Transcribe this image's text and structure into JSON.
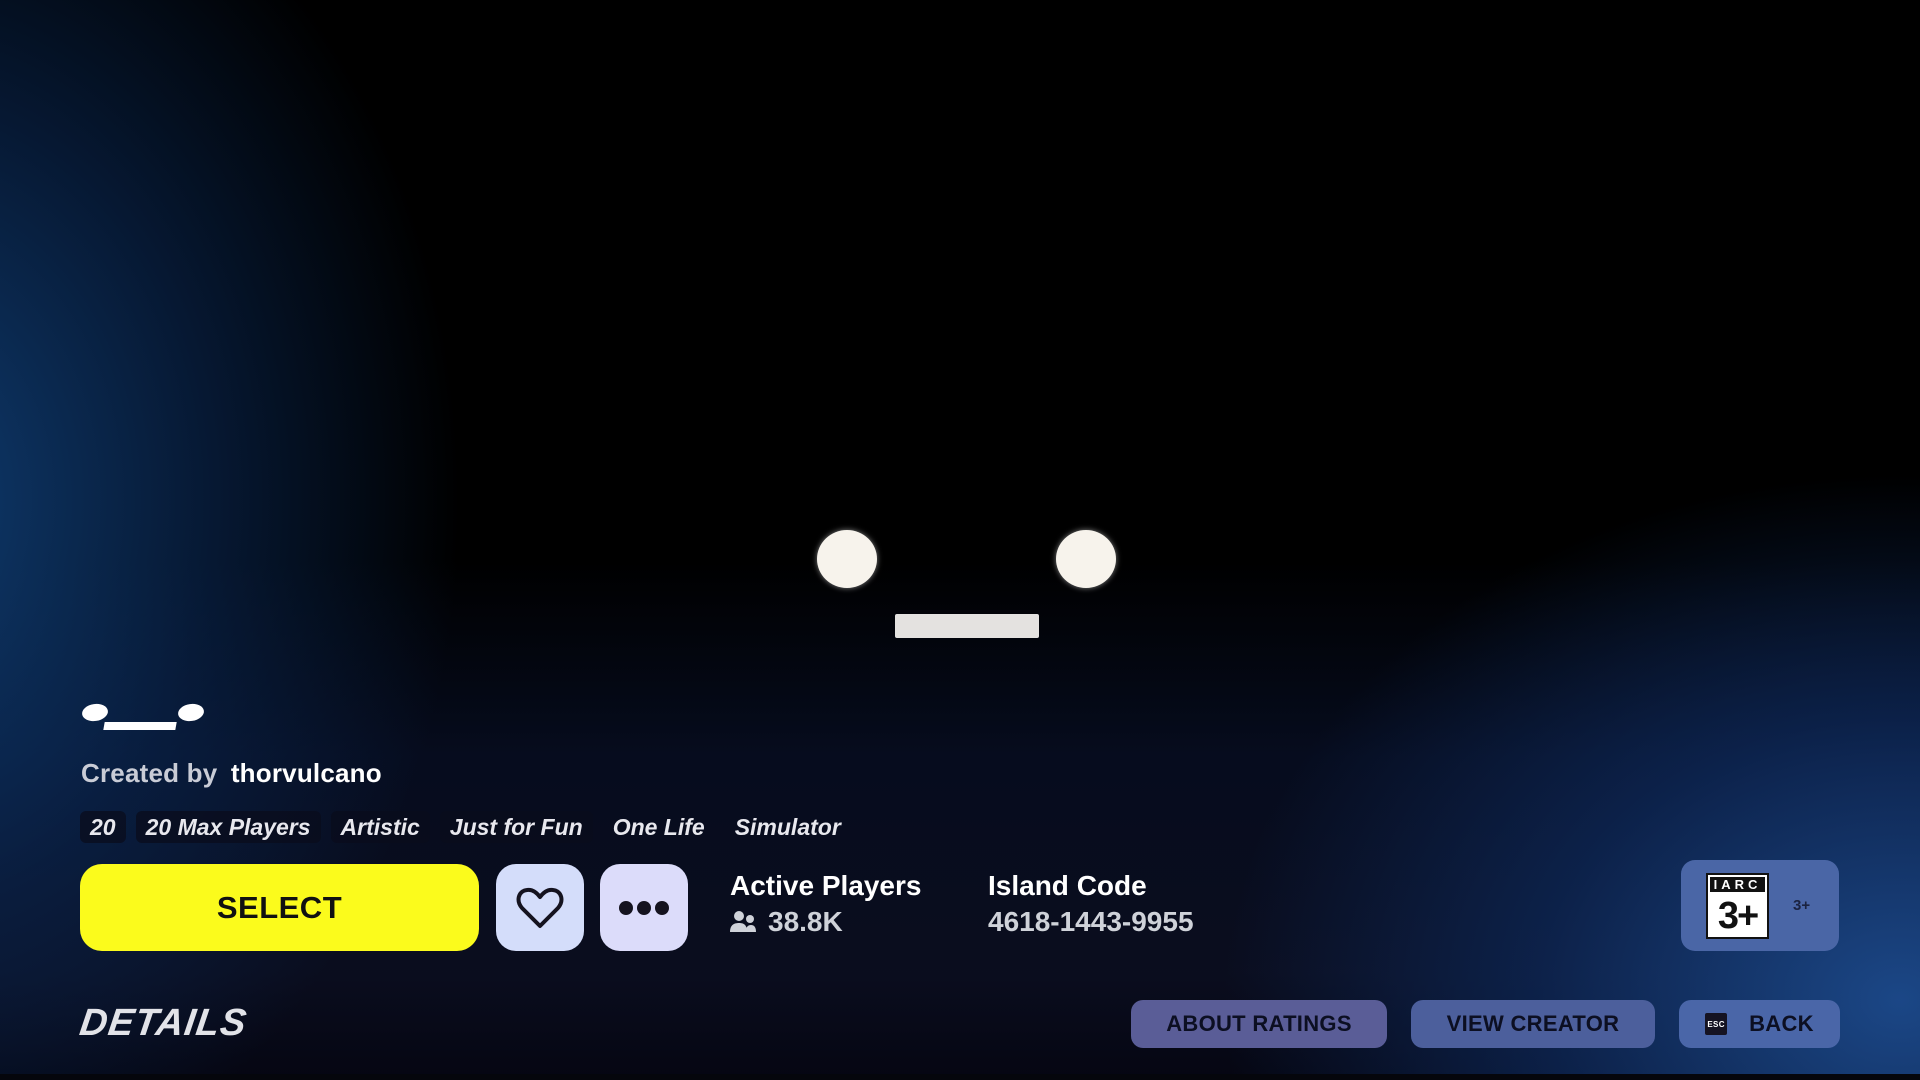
{
  "island": {
    "title": "•__•",
    "created_by_label": "Created by",
    "creator": "thorvulcano",
    "tags": [
      "20",
      "20 Max Players",
      "Artistic",
      "Just for Fun",
      "One Life",
      "Simulator"
    ]
  },
  "actions": {
    "select_label": "SELECT",
    "favorite_icon": "heart-icon",
    "more_icon": "more-dots-icon"
  },
  "stats": {
    "active_players_label": "Active Players",
    "active_players_value": "38.8K",
    "players_icon": "people-icon",
    "island_code_label": "Island Code",
    "island_code_value": "4618-1443-9955"
  },
  "rating": {
    "board": "IARC",
    "age": "3+",
    "label": "3+"
  },
  "footer": {
    "details_label": "DETAILS",
    "about_ratings_label": "ABOUT RATINGS",
    "view_creator_label": "VIEW CREATOR",
    "back_key": "ESC",
    "back_label": "BACK"
  },
  "colors": {
    "select_yellow": "#fbfb1c",
    "fav_button": "#d4ddfa",
    "more_button": "#dcdcfa",
    "rating_box": "#4a66a6",
    "footer_button": "#4c5f9c"
  }
}
